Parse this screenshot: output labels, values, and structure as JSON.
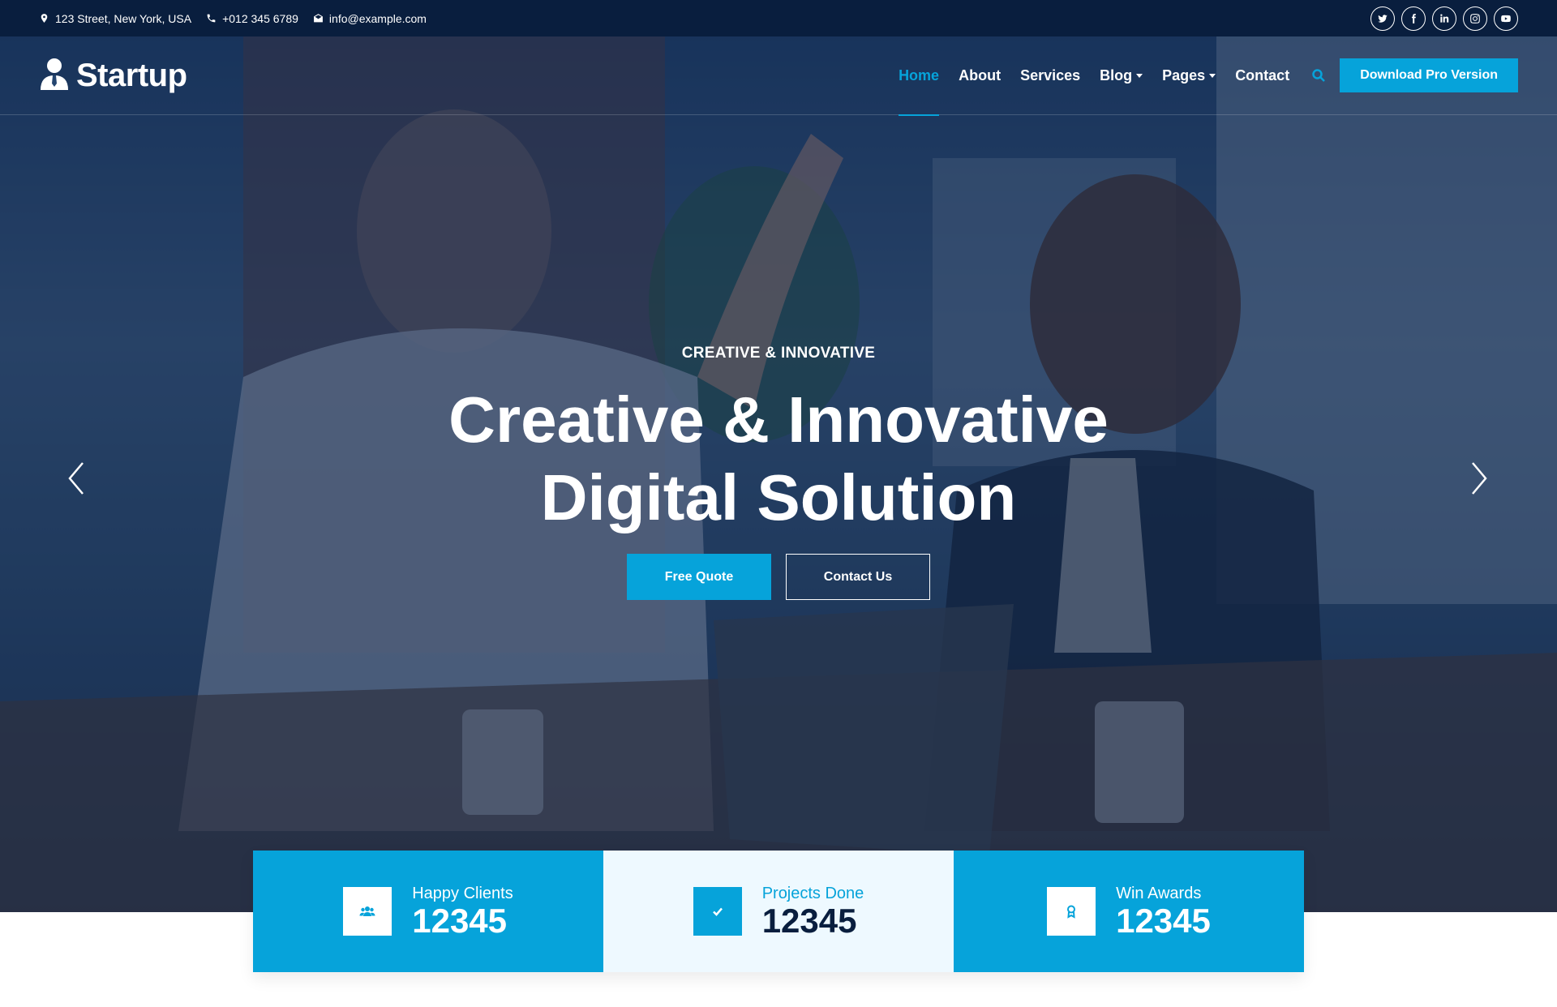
{
  "topbar": {
    "address": "123 Street, New York, USA",
    "phone": "+012 345 6789",
    "email": "info@example.com",
    "social": [
      "twitter-icon",
      "facebook-icon",
      "linkedin-icon",
      "instagram-icon",
      "youtube-icon"
    ]
  },
  "brand": {
    "name": "Startup"
  },
  "nav": {
    "items": [
      "Home",
      "About",
      "Services",
      "Blog",
      "Pages",
      "Contact"
    ],
    "active": "Home",
    "cta": "Download Pro Version"
  },
  "hero": {
    "subtitle": "CREATIVE & INNOVATIVE",
    "title_line1": "Creative & Innovative",
    "title_line2": "Digital Solution",
    "primary_button": "Free Quote",
    "secondary_button": "Contact Us"
  },
  "stats": [
    {
      "label": "Happy Clients",
      "value": "12345",
      "icon": "users-icon"
    },
    {
      "label": "Projects Done",
      "value": "12345",
      "icon": "check-icon"
    },
    {
      "label": "Win Awards",
      "value": "12345",
      "icon": "award-icon"
    }
  ],
  "colors": {
    "primary": "#06a3da",
    "dark": "#091e3e",
    "light": "#eef9ff"
  }
}
